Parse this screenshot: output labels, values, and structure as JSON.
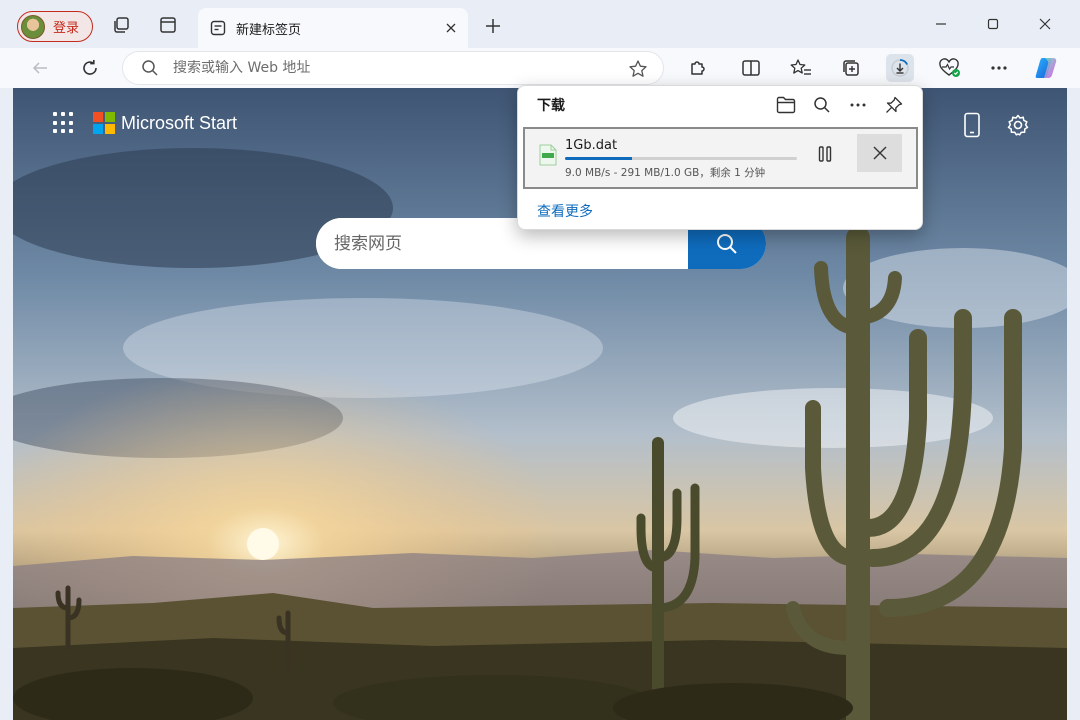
{
  "colors": {
    "accent": "#0f6cbd",
    "profile_border": "#c42b1c"
  },
  "profile": {
    "label": "登录"
  },
  "tab": {
    "title": "新建标签页"
  },
  "address": {
    "placeholder": "搜索或输入 Web 地址"
  },
  "page": {
    "brand": "Microsoft Start",
    "search_placeholder": "搜索网页"
  },
  "downloads": {
    "title": "下载",
    "item": {
      "file_name": "1Gb.dat",
      "status": "9.0 MB/s - 291 MB/1.0 GB，剩余 1 分钟",
      "progress": 0.29
    },
    "see_more": "查看更多"
  }
}
